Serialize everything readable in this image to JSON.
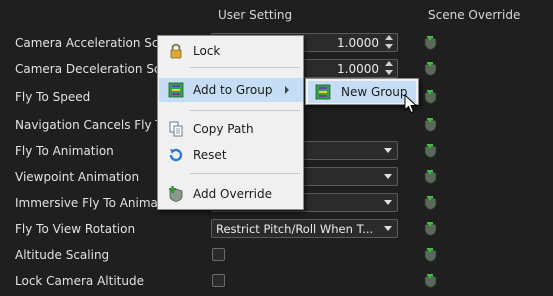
{
  "headers": {
    "user_setting": "User Setting",
    "scene_override": "Scene Override"
  },
  "rows": [
    {
      "label": "Camera Acceleration Scale",
      "control": "spinner",
      "value": "1.0000"
    },
    {
      "label": "Camera Deceleration Scale",
      "control": "spinner",
      "value": "1.0000"
    },
    {
      "label": "Fly To Speed",
      "control": "none",
      "value": ""
    },
    {
      "label": "Navigation Cancels Fly To",
      "control": "none",
      "value": ""
    },
    {
      "label": "Fly To Animation",
      "control": "dropdown",
      "value": ""
    },
    {
      "label": "Viewpoint Animation",
      "control": "dropdown",
      "value": ""
    },
    {
      "label": "Immersive Fly To Animation",
      "control": "dropdown",
      "value": ""
    },
    {
      "label": "Fly To View Rotation",
      "control": "dropdown",
      "value": "Restrict Pitch/Roll When T..."
    },
    {
      "label": "Altitude Scaling",
      "control": "checkbox",
      "value": ""
    },
    {
      "label": "Lock Camera Altitude",
      "control": "checkbox",
      "value": ""
    }
  ],
  "context_menu": {
    "items": [
      {
        "label": "Lock",
        "icon": "lock-icon"
      },
      {
        "label": "Add to Group",
        "icon": "group-icon",
        "has_submenu": true
      },
      {
        "label": "Copy Path",
        "icon": "copy-icon"
      },
      {
        "label": "Reset",
        "icon": "reset-icon"
      },
      {
        "label": "Add Override",
        "icon": "add-override-icon"
      }
    ]
  },
  "submenu": {
    "items": [
      {
        "label": "New Group",
        "icon": "group-icon"
      }
    ]
  },
  "colors": {
    "background": "#1f1f1f",
    "menu_bg": "#f0f0f0",
    "menu_highlight": "#c6def5",
    "override_green": "#3fbf3f"
  }
}
